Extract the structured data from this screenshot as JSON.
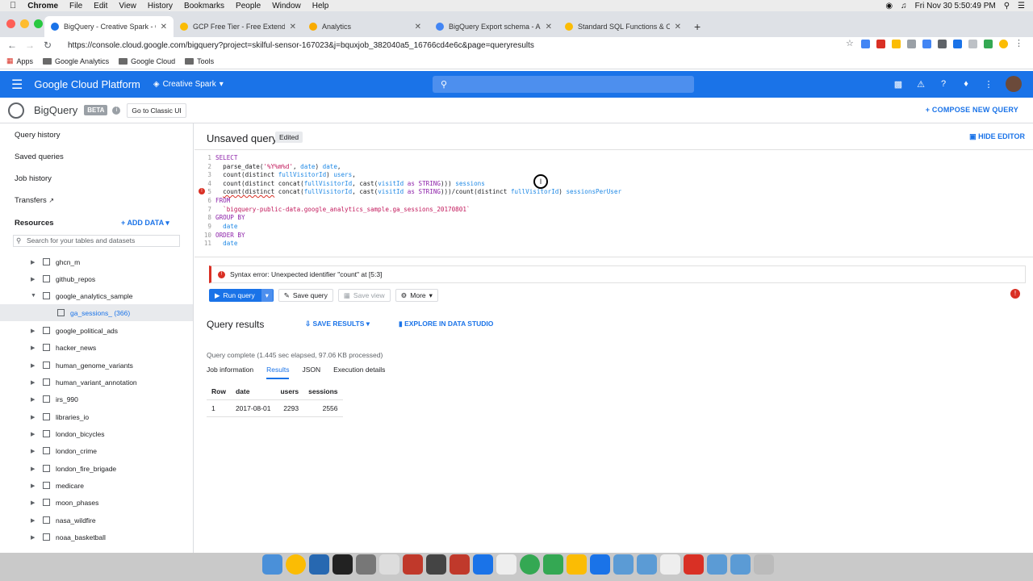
{
  "menubar": {
    "app": "Chrome",
    "items": [
      "File",
      "Edit",
      "View",
      "History",
      "Bookmarks",
      "People",
      "Window",
      "Help"
    ],
    "clock": "Fri Nov 30  5:50:49 PM"
  },
  "tabs": [
    {
      "title": "BigQuery - Creative Spark - Go",
      "active": true,
      "color": "#1a73e8"
    },
    {
      "title": "GCP Free Tier - Free Extended",
      "active": false,
      "color": "#fbbc04"
    },
    {
      "title": "Analytics",
      "active": false,
      "color": "#f9ab00"
    },
    {
      "title": "BigQuery Export schema - Ana",
      "active": false,
      "color": "#4285f4"
    },
    {
      "title": "Standard SQL Functions & Ope",
      "active": false,
      "color": "#fbbc04"
    }
  ],
  "address": {
    "url": "https://console.cloud.google.com/bigquery?project=skilful-sensor-167023&j=bquxjob_382040a5_16766cd4e6c&page=queryresults"
  },
  "bookmarks": [
    "Apps",
    "Google Analytics",
    "Google Cloud",
    "Tools"
  ],
  "gcp": {
    "title": "Google Cloud Platform",
    "project": "Creative Spark"
  },
  "bq": {
    "name": "BigQuery",
    "beta": "BETA",
    "classic": "Go to Classic UI",
    "compose": "COMPOSE NEW QUERY"
  },
  "sidebar": {
    "nav": [
      "Query history",
      "Saved queries",
      "Job history",
      "Transfers"
    ],
    "resources": "Resources",
    "add_data": "ADD DATA",
    "search_placeholder": "Search for your tables and datasets",
    "tree": [
      {
        "label": "ghcn_m"
      },
      {
        "label": "github_repos"
      },
      {
        "label": "google_analytics_sample",
        "open": true
      },
      {
        "label": "ga_sessions_ (366)",
        "table": true
      },
      {
        "label": "google_political_ads"
      },
      {
        "label": "hacker_news"
      },
      {
        "label": "human_genome_variants"
      },
      {
        "label": "human_variant_annotation"
      },
      {
        "label": "irs_990"
      },
      {
        "label": "libraries_io"
      },
      {
        "label": "london_bicycles"
      },
      {
        "label": "london_crime"
      },
      {
        "label": "london_fire_brigade"
      },
      {
        "label": "medicare"
      },
      {
        "label": "moon_phases"
      },
      {
        "label": "nasa_wildfire"
      },
      {
        "label": "noaa_basketball"
      }
    ]
  },
  "main": {
    "title": "Unsaved query",
    "edited": "Edited",
    "hide_editor": "HIDE EDITOR",
    "error": "Syntax error: Unexpected identifier \"count\" at [5:3]",
    "buttons": {
      "run": "Run query",
      "save": "Save query",
      "view": "Save view",
      "more": "More"
    },
    "results_title": "Query results",
    "save_results": "SAVE RESULTS",
    "explore": "EXPLORE IN DATA STUDIO",
    "complete": "Query complete (1.445 sec elapsed, 97.06 KB processed)",
    "result_tabs": [
      "Job information",
      "Results",
      "JSON",
      "Execution details"
    ],
    "table": {
      "headers": [
        "Row",
        "date",
        "users",
        "sessions"
      ],
      "rows": [
        [
          "1",
          "2017-08-01",
          "2293",
          "2556"
        ]
      ]
    }
  }
}
